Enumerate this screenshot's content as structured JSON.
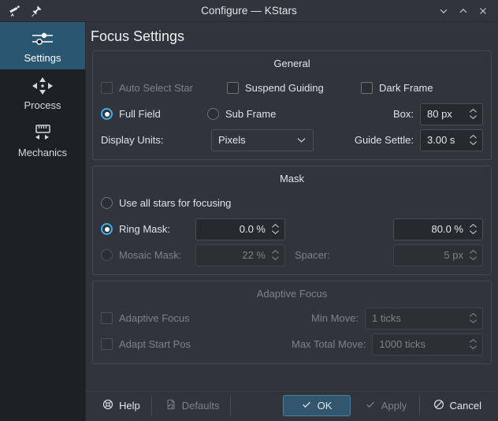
{
  "window": {
    "title": "Configure — KStars",
    "app_icon": "telescope-icon",
    "pin_icon": "pin-icon",
    "controls": [
      {
        "name": "minimize-button",
        "icon": "chevron-down-icon"
      },
      {
        "name": "maximize-button",
        "icon": "chevron-up-icon"
      },
      {
        "name": "close-button",
        "icon": "close-icon"
      }
    ]
  },
  "sidebar": {
    "items": [
      {
        "label": "Settings",
        "icon": "sliders-icon",
        "selected": true
      },
      {
        "label": "Process",
        "icon": "move-arrows-icon",
        "selected": false
      },
      {
        "label": "Mechanics",
        "icon": "ruler-icon",
        "selected": false
      }
    ]
  },
  "page": {
    "title": "Focus Settings"
  },
  "general": {
    "title": "General",
    "auto_select_star": {
      "label": "Auto Select Star",
      "checked": false,
      "enabled": false
    },
    "suspend_guiding": {
      "label": "Suspend Guiding",
      "checked": false,
      "enabled": true
    },
    "dark_frame": {
      "label": "Dark Frame",
      "checked": false,
      "enabled": true
    },
    "full_field": {
      "label": "Full Field",
      "selected": true
    },
    "sub_frame": {
      "label": "Sub Frame",
      "selected": false
    },
    "box": {
      "label": "Box:",
      "value": "80 px"
    },
    "display_units": {
      "label": "Display Units:",
      "value": "Pixels"
    },
    "guide_settle": {
      "label": "Guide Settle:",
      "value": "3.00 s"
    }
  },
  "mask": {
    "title": "Mask",
    "use_all_stars": {
      "label": "Use all stars for focusing",
      "selected": false
    },
    "ring_mask": {
      "label": "Ring Mask:",
      "selected": true,
      "inner": "0.0 %",
      "outer": "80.0 %"
    },
    "mosaic_mask": {
      "label": "Mosaic Mask:",
      "selected": false,
      "enabled": false,
      "tile": "22 %",
      "spacer_label": "Spacer:",
      "spacer": "5 px"
    }
  },
  "adaptive": {
    "title": "Adaptive Focus",
    "enabled": false,
    "adaptive_focus": {
      "label": "Adaptive Focus",
      "checked": false
    },
    "adapt_start_pos": {
      "label": "Adapt Start Pos",
      "checked": false
    },
    "min_move": {
      "label": "Min Move:",
      "value": "1 ticks"
    },
    "max_total_move": {
      "label": "Max Total Move:",
      "value": "1000 ticks"
    }
  },
  "buttons": {
    "help": {
      "label": "Help",
      "icon": "lifebuoy-icon",
      "enabled": true
    },
    "defaults": {
      "label": "Defaults",
      "icon": "document-reset-icon",
      "enabled": false
    },
    "ok": {
      "label": "OK",
      "icon": "check-icon",
      "enabled": true,
      "primary": true
    },
    "apply": {
      "label": "Apply",
      "icon": "check-icon",
      "enabled": false
    },
    "cancel": {
      "label": "Cancel",
      "icon": "cancel-icon",
      "enabled": true
    }
  },
  "colors": {
    "accent": "#3daee9",
    "sidebar_selected": "#2a5672",
    "primary_button": "#31566e",
    "window_bg": "#31353b"
  }
}
